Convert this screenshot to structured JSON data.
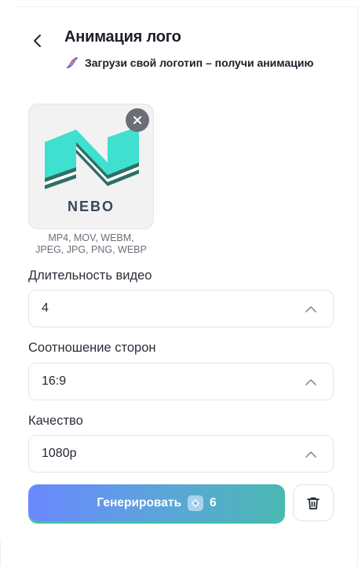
{
  "header": {
    "title": "Анимация лого",
    "subtitle": "Загрузи свой логотип – получи анимацию",
    "back_icon": "chevron-left-icon",
    "subtitle_icon": "dna-icon"
  },
  "upload": {
    "preview_text": "NEBO",
    "formats_line1": "MP4, MOV, WEBM,",
    "formats_line2": "JPEG, JPG, PNG, WEBP",
    "remove_icon": "close-icon"
  },
  "fields": [
    {
      "label": "Длительность видео",
      "value": "4"
    },
    {
      "label": "Соотношение сторон",
      "value": "16:9"
    },
    {
      "label": "Качество",
      "value": "1080p"
    }
  ],
  "actions": {
    "generate_label": "Генерировать",
    "generate_cost": "6",
    "cost_icon": "gem-icon",
    "delete_icon": "trash-icon"
  },
  "colors": {
    "gradient_start": "#6b88ff",
    "gradient_end": "#49b8b0",
    "logo_teal": "#3fe0cf",
    "logo_dark": "#2e6f66"
  }
}
